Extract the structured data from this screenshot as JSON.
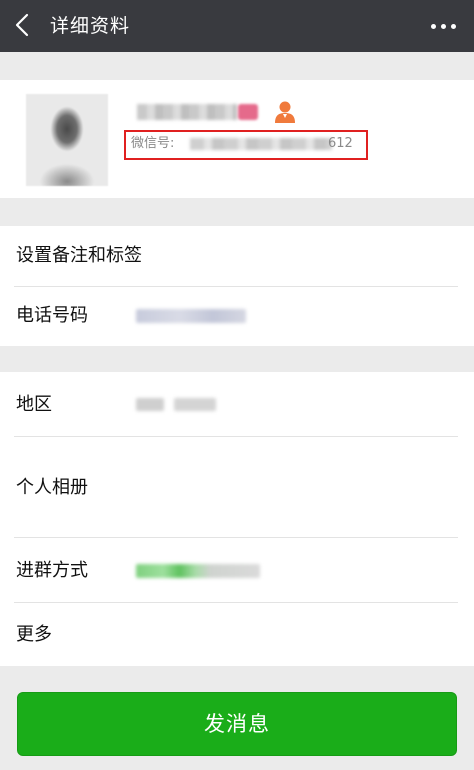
{
  "header": {
    "title": "详细资料"
  },
  "profile": {
    "wechat_id_label": "微信号:",
    "wechat_id_suffix": "612"
  },
  "rows": {
    "remark_tags": "设置备注和标签",
    "phone": "电话号码",
    "region": "地区",
    "album": "个人相册",
    "join_method": "进群方式",
    "more": "更多"
  },
  "actions": {
    "send_message": "发消息"
  },
  "colors": {
    "topbar": "#393a3f",
    "accent_green": "#1aad19",
    "highlight_red": "#e02020",
    "page_bg": "#ebebeb"
  },
  "icons": {
    "back": "chevron-left-icon",
    "more": "more-dots-icon",
    "person": "person-icon"
  }
}
